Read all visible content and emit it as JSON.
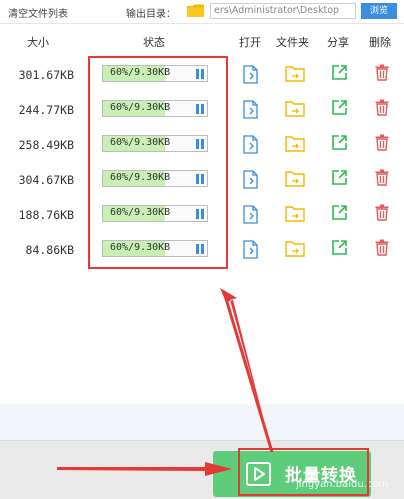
{
  "toolbar": {
    "clear_label": "清空文件列表",
    "output_label": "输出目录：",
    "path_value": "ers\\Administrator\\Desktop",
    "browse_label": "浏览"
  },
  "headers": {
    "size": "大小",
    "status": "状态",
    "open": "打开",
    "folder": "文件夹",
    "share": "分享",
    "delete": "删除"
  },
  "rows": [
    {
      "size": "301.67KB",
      "status": "60%/9.30KB",
      "progress": 0.6
    },
    {
      "size": "244.77KB",
      "status": "60%/9.30KB",
      "progress": 0.6
    },
    {
      "size": "258.49KB",
      "status": "60%/9.30KB",
      "progress": 0.6
    },
    {
      "size": "304.67KB",
      "status": "60%/9.30KB",
      "progress": 0.6
    },
    {
      "size": "188.76KB",
      "status": "60%/9.30KB",
      "progress": 0.6
    },
    {
      "size": "84.86KB",
      "status": "60%/9.30KB",
      "progress": 0.6
    }
  ],
  "footer": {
    "batch_label": "批量转换",
    "watermark": "jingyan.baidu.com"
  },
  "icons": {
    "open": "file-icon",
    "folder": "folder-icon",
    "share": "share-icon",
    "delete": "trash-icon",
    "pause": "pause-icon",
    "play": "play-icon"
  },
  "colors": {
    "accent": "#3b8de0",
    "progress_fill": "#c9f0b4",
    "folder": "#f5b800",
    "share": "#2dbd55",
    "delete": "#e85a5a",
    "batch_button": "#5ecd7b",
    "annotation": "#e53935"
  }
}
